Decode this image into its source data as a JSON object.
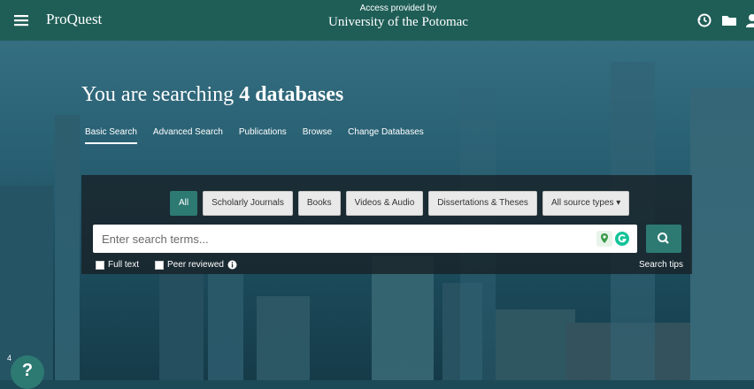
{
  "header": {
    "brand": "ProQuest",
    "access_label": "Access provided by",
    "institution": "University of the Potomac"
  },
  "headline": {
    "prefix": "You are searching ",
    "emphasis": "4 databases"
  },
  "tabs": [
    {
      "label": "Basic Search"
    },
    {
      "label": "Advanced Search"
    },
    {
      "label": "Publications"
    },
    {
      "label": "Browse"
    },
    {
      "label": "Change Databases"
    }
  ],
  "source_types": [
    {
      "label": "All"
    },
    {
      "label": "Scholarly Journals"
    },
    {
      "label": "Books"
    },
    {
      "label": "Videos & Audio"
    },
    {
      "label": "Dissertations & Theses"
    },
    {
      "label": "All source types ▾"
    }
  ],
  "search": {
    "placeholder": "Enter search terms...",
    "value": ""
  },
  "options": {
    "full_text": "Full text",
    "peer_reviewed": "Peer reviewed"
  },
  "search_tips": "Search tips",
  "help": {
    "count": "4",
    "symbol": "?"
  },
  "colors": {
    "topbar": "#1f5e57",
    "accent": "#2d7a73"
  }
}
